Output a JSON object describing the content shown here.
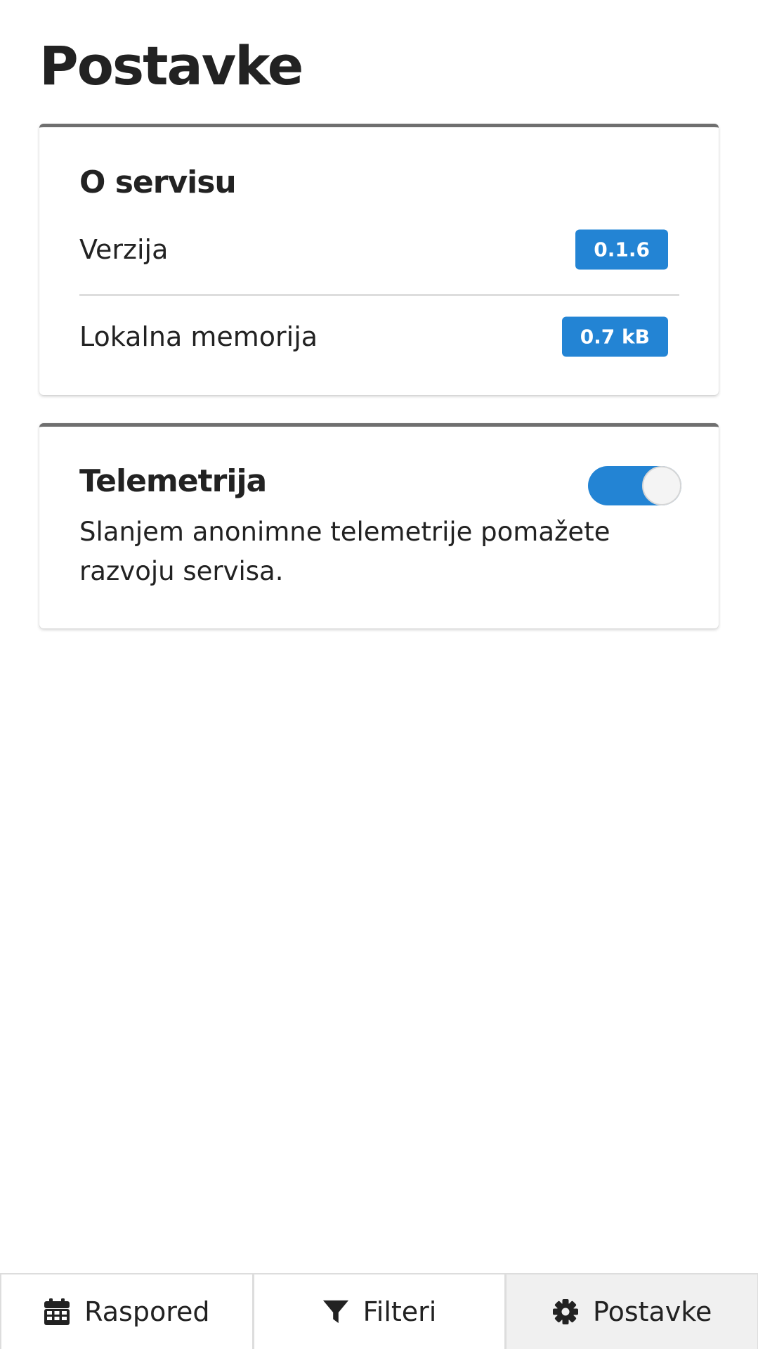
{
  "page": {
    "title": "Postavke"
  },
  "about": {
    "heading": "O servisu",
    "rows": [
      {
        "label": "Verzija",
        "value": "0.1.6"
      },
      {
        "label": "Lokalna memorija",
        "value": "0.7 kB"
      }
    ]
  },
  "telemetry": {
    "heading": "Telemetrija",
    "description": "Slanjem anonimne telemetrije pomažete razvoju servisa.",
    "enabled": true
  },
  "tabbar": {
    "tabs": [
      {
        "label": "Raspored",
        "icon": "calendar-icon",
        "active": false
      },
      {
        "label": "Filteri",
        "icon": "filter-icon",
        "active": false
      },
      {
        "label": "Postavke",
        "icon": "gear-icon",
        "active": true
      }
    ]
  },
  "colors": {
    "accent": "#2384d4",
    "text": "#222222",
    "card_top_border": "#6f6f6f",
    "active_tab_bg": "#f0f0f0"
  }
}
